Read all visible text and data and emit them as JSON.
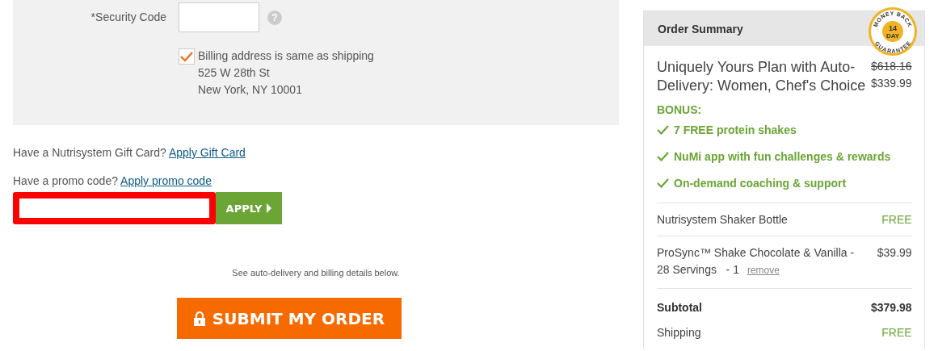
{
  "payment": {
    "security_code": {
      "label": "*Security Code",
      "help": "?"
    },
    "billing_same": {
      "label": "Billing address is same as shipping",
      "checked": true,
      "address": [
        "525 W 28th St",
        "New York, NY 10001"
      ]
    }
  },
  "gift_card": {
    "prompt": "Have a Nutrisystem Gift Card?",
    "link": "Apply Gift Card"
  },
  "promo": {
    "prompt": "Have a promo code?",
    "link": "Apply promo code",
    "field": {
      "highlighted": true
    },
    "button": "APPLY"
  },
  "note": "See auto-delivery and billing details below.",
  "submit": "SUBMIT MY ORDER",
  "summary": {
    "title": "Order Summary",
    "badge": {
      "top": "MONEY BACK",
      "days": "14",
      "unit": "DAY",
      "bottom": "GUARANTEE"
    },
    "plan": {
      "name": "Uniquely Yours Plan with Auto-Delivery: Women, Chef's Choice",
      "old_price": "$618.16",
      "price": "$339.99"
    },
    "bonus_title": "BONUS:",
    "bonuses": [
      "7 FREE protein shakes",
      "NuMi app with fun challenges & rewards",
      "On-demand coaching & support"
    ],
    "items": [
      {
        "name": "Nutrisystem Shaker Bottle",
        "price": "FREE",
        "free": true
      },
      {
        "name": "ProSync™ Shake Chocolate & Vanilla - 28 Servings",
        "qty": "- 1",
        "remove": "remove",
        "price": "$39.99",
        "free": false
      }
    ],
    "totals": [
      {
        "label": "Subtotal",
        "value": "$379.98",
        "kind": "bold"
      },
      {
        "label": "Shipping",
        "value": "FREE",
        "kind": "free"
      }
    ]
  }
}
